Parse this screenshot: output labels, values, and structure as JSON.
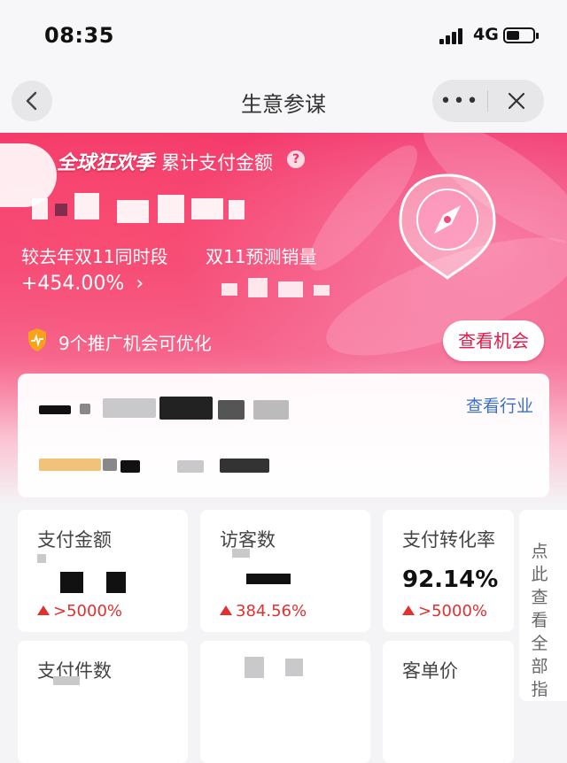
{
  "status_bar": {
    "time": "08:35",
    "network": "4G"
  },
  "nav": {
    "title": "生意参谋",
    "more_label": "•••"
  },
  "hero": {
    "promo_text": "全球狂欢季",
    "metric_label": "累计支付金额",
    "compare_label": "较去年双11同时段",
    "growth_value": "+454.00%",
    "forecast_label": "双11预测销量",
    "opportunity_text": "9个推广机会可优化",
    "opportunity_button": "查看机会"
  },
  "industry_card": {
    "link_label": "查看行业"
  },
  "metrics": [
    {
      "label": "支付金额",
      "value": "",
      "change": ">5000%"
    },
    {
      "label": "访客数",
      "value": "",
      "change": "384.56%"
    },
    {
      "label": "支付转化率",
      "value": "92.14%",
      "change": ">5000%"
    },
    {
      "label": "支付件数",
      "value": "",
      "change": ""
    },
    {
      "label": "",
      "value": "",
      "change": ""
    },
    {
      "label": "客单价",
      "value": "",
      "change": ""
    }
  ],
  "side_tip": "点此查看全部指",
  "colors": {
    "accent": "#f0336a",
    "link": "#3a70c9",
    "up": "#e2302f"
  }
}
